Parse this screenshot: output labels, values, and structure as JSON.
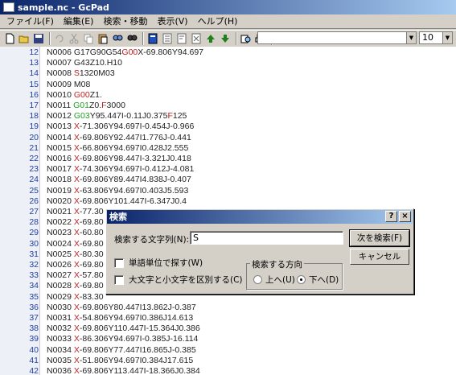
{
  "window": {
    "title": "sample.nc - GcPad"
  },
  "menu": [
    "ファイル(F)",
    "編集(E)",
    "検索・移動",
    "表示(V)",
    "ヘルプ(H)"
  ],
  "toolbar": {
    "icons": [
      "new-file-icon",
      "open-folder-icon",
      "save-icon",
      "undo-icon",
      "cut-icon",
      "copy-icon",
      "paste-icon",
      "find-icon",
      "find-next-icon",
      "view1-icon",
      "view2-icon",
      "view3-icon",
      "view4-icon",
      "up-icon",
      "down-icon",
      "print-preview-icon",
      "print-icon",
      "help-icon"
    ],
    "font_name": "",
    "font_size": "10"
  },
  "editor": {
    "lines": [
      {
        "n": "12",
        "parts": [
          [
            "N0006 G17G90G54",
            ""
          ],
          [
            "G00",
            "red"
          ],
          [
            "X-69.806Y94.697",
            ""
          ]
        ]
      },
      {
        "n": "13",
        "parts": [
          [
            "N0007 G43Z10.H10",
            ""
          ]
        ]
      },
      {
        "n": "14",
        "parts": [
          [
            "N0008 ",
            ""
          ],
          [
            "S",
            "red"
          ],
          [
            "1320M03",
            ""
          ]
        ]
      },
      {
        "n": "15",
        "parts": [
          [
            "N0009 M08",
            ""
          ]
        ]
      },
      {
        "n": "16",
        "parts": [
          [
            "N0010 ",
            ""
          ],
          [
            "G00",
            "red"
          ],
          [
            "Z1.",
            ""
          ]
        ]
      },
      {
        "n": "17",
        "parts": [
          [
            "N0011 ",
            ""
          ],
          [
            "G01",
            "green"
          ],
          [
            "Z0.",
            ""
          ],
          [
            "F",
            "red"
          ],
          [
            "3000",
            ""
          ]
        ]
      },
      {
        "n": "18",
        "parts": [
          [
            "N0012 ",
            ""
          ],
          [
            "G03",
            "green"
          ],
          [
            "Y95.447I-0.11J0.375",
            ""
          ],
          [
            "F",
            "red"
          ],
          [
            "125",
            ""
          ]
        ]
      },
      {
        "n": "19",
        "parts": [
          [
            "N0013 ",
            ""
          ],
          [
            "X",
            "red"
          ],
          [
            "-71.306Y94.697I-0.454J-0.966",
            ""
          ]
        ]
      },
      {
        "n": "20",
        "parts": [
          [
            "N0014 ",
            ""
          ],
          [
            "X",
            "red"
          ],
          [
            "-69.806Y92.447I1.776J-0.441",
            ""
          ]
        ]
      },
      {
        "n": "21",
        "parts": [
          [
            "N0015 ",
            ""
          ],
          [
            "X",
            "red"
          ],
          [
            "-66.806Y94.697I0.428J2.555",
            ""
          ]
        ]
      },
      {
        "n": "22",
        "parts": [
          [
            "N0016 ",
            ""
          ],
          [
            "X",
            "red"
          ],
          [
            "-69.806Y98.447I-3.321J0.418",
            ""
          ]
        ]
      },
      {
        "n": "23",
        "parts": [
          [
            "N0017 ",
            ""
          ],
          [
            "X",
            "red"
          ],
          [
            "-74.306Y94.697I-0.412J-4.081",
            ""
          ]
        ]
      },
      {
        "n": "24",
        "parts": [
          [
            "N0018 ",
            ""
          ],
          [
            "X",
            "red"
          ],
          [
            "-69.806Y89.447I4.838J-0.407",
            ""
          ]
        ]
      },
      {
        "n": "25",
        "parts": [
          [
            "N0019 ",
            ""
          ],
          [
            "X",
            "red"
          ],
          [
            "-63.806Y94.697I0.403J5.593",
            ""
          ]
        ]
      },
      {
        "n": "26",
        "parts": [
          [
            "N0020 ",
            ""
          ],
          [
            "X",
            "red"
          ],
          [
            "-69.806Y101.447I-6.347J0.4",
            ""
          ]
        ]
      },
      {
        "n": "27",
        "parts": [
          [
            "N0021 ",
            ""
          ],
          [
            "X",
            "red"
          ],
          [
            "-77.30",
            ""
          ]
        ]
      },
      {
        "n": "28",
        "parts": [
          [
            "N0022 ",
            ""
          ],
          [
            "X",
            "red"
          ],
          [
            "-69.80",
            ""
          ]
        ]
      },
      {
        "n": "29",
        "parts": [
          [
            "N0023 ",
            ""
          ],
          [
            "X",
            "red"
          ],
          [
            "-60.80",
            ""
          ]
        ]
      },
      {
        "n": "30",
        "parts": [
          [
            "N0024 ",
            ""
          ],
          [
            "X",
            "red"
          ],
          [
            "-69.80",
            ""
          ]
        ]
      },
      {
        "n": "31",
        "parts": [
          [
            "N0025 ",
            ""
          ],
          [
            "X",
            "red"
          ],
          [
            "-80.30",
            ""
          ]
        ]
      },
      {
        "n": "32",
        "parts": [
          [
            "N0026 ",
            ""
          ],
          [
            "X",
            "red"
          ],
          [
            "-69.80",
            ""
          ]
        ]
      },
      {
        "n": "33",
        "parts": [
          [
            "N0027 ",
            ""
          ],
          [
            "X",
            "red"
          ],
          [
            "-57.80",
            ""
          ]
        ]
      },
      {
        "n": "34",
        "parts": [
          [
            "N0028 ",
            ""
          ],
          [
            "X",
            "red"
          ],
          [
            "-69.80",
            ""
          ]
        ]
      },
      {
        "n": "35",
        "parts": [
          [
            "N0029 ",
            ""
          ],
          [
            "X",
            "red"
          ],
          [
            "-83.30",
            ""
          ]
        ]
      },
      {
        "n": "36",
        "parts": [
          [
            "N0030 ",
            ""
          ],
          [
            "X",
            "red"
          ],
          [
            "-69.806Y80.447I13.862J-0.387",
            ""
          ]
        ]
      },
      {
        "n": "37",
        "parts": [
          [
            "N0031 ",
            ""
          ],
          [
            "X",
            "red"
          ],
          [
            "-54.806Y94.697I0.386J14.613",
            ""
          ]
        ]
      },
      {
        "n": "38",
        "parts": [
          [
            "N0032 ",
            ""
          ],
          [
            "X",
            "red"
          ],
          [
            "-69.806Y110.447I-15.364J0.386",
            ""
          ]
        ]
      },
      {
        "n": "39",
        "parts": [
          [
            "N0033 ",
            ""
          ],
          [
            "X",
            "red"
          ],
          [
            "-86.306Y94.697I-0.385J-16.114",
            ""
          ]
        ]
      },
      {
        "n": "40",
        "parts": [
          [
            "N0034 ",
            ""
          ],
          [
            "X",
            "red"
          ],
          [
            "-69.806Y77.447I16.865J-0.385",
            ""
          ]
        ]
      },
      {
        "n": "41",
        "parts": [
          [
            "N0035 ",
            ""
          ],
          [
            "X",
            "red"
          ],
          [
            "-51.806Y94.697I0.384J17.615",
            ""
          ]
        ]
      },
      {
        "n": "42",
        "parts": [
          [
            "N0036 ",
            ""
          ],
          [
            "X",
            "red"
          ],
          [
            "-69.806Y113.447I-18.366J0.384",
            ""
          ]
        ]
      }
    ]
  },
  "find_dialog": {
    "title": "検索",
    "help_btn": "?",
    "close_btn": "×",
    "label": "検索する文字列(N):",
    "value": "S",
    "find_next": "次を検索(F)",
    "cancel": "キャンセル",
    "whole_word": "単語単位で探す(W)",
    "match_case": "大文字と小文字を区別する(C)",
    "direction_label": "検索する方向",
    "dir_up": "上へ(U)",
    "dir_down": "下へ(D)"
  },
  "colors": {
    "keyword_red": "#c02020",
    "keyword_green": "#20a020",
    "line_number": "#2040a0"
  }
}
